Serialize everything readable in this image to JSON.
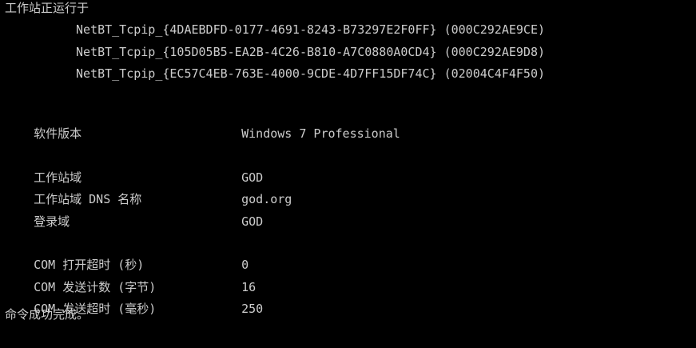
{
  "colors": {
    "background": "#000000",
    "text": "#cccccc"
  },
  "console": {
    "running_on_label": "工作站正运行于",
    "transports": [
      "NetBT_Tcpip_{4DAEBDFD-0177-4691-8243-B73297E2F0FF} (000C292AE9CE)",
      "NetBT_Tcpip_{105D05B5-EA2B-4C26-B810-A7C0880A0CD4} (000C292AE9D8)",
      "NetBT_Tcpip_{EC57C4EB-763E-4000-9CDE-4D7FF15DF74C} (02004C4F4F50)"
    ],
    "software_version": {
      "label": "软件版本",
      "value": "Windows 7 Professional"
    },
    "workstation_domain": {
      "label": "工作站域",
      "value": "GOD"
    },
    "workstation_dns_name": {
      "label": "工作站域 DNS 名称",
      "value": "god.org"
    },
    "logon_domain": {
      "label": "登录域",
      "value": "GOD"
    },
    "com_open_timeout": {
      "label": "COM 打开超时 (秒)",
      "value": "0"
    },
    "com_send_count": {
      "label": "COM 发送计数 (字节)",
      "value": "16"
    },
    "com_send_timeout": {
      "label": "COM 发送超时 (毫秒)",
      "value": "250"
    },
    "completion_message": "命令成功完成。"
  }
}
